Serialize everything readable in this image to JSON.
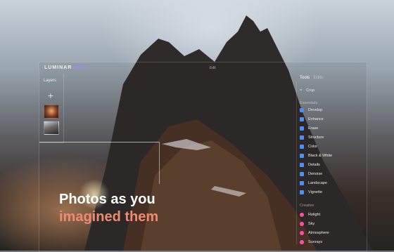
{
  "app": {
    "brand": "LUMINAR",
    "brand_suffix": "NEO",
    "center_title": "Edit",
    "accent_color": "#4f8df1",
    "creative_color": "#ff4fa6"
  },
  "layers": {
    "title": "Layers",
    "add_icon": "plus-icon"
  },
  "hero": {
    "line1": "Photos as you",
    "line2": "imagined them"
  },
  "panel": {
    "tabs": [
      "Tools",
      "Edits"
    ],
    "crop": "Crop",
    "essentials_label": "Essentials",
    "essentials": [
      "Develop",
      "Enhance",
      "Erase",
      "Structure",
      "Color",
      "Black & White",
      "Details",
      "Denoise",
      "Landscape",
      "Vignette"
    ],
    "creative_label": "Creative",
    "creative": [
      "Relight",
      "Sky",
      "Atmosphere",
      "Sunrays"
    ]
  }
}
